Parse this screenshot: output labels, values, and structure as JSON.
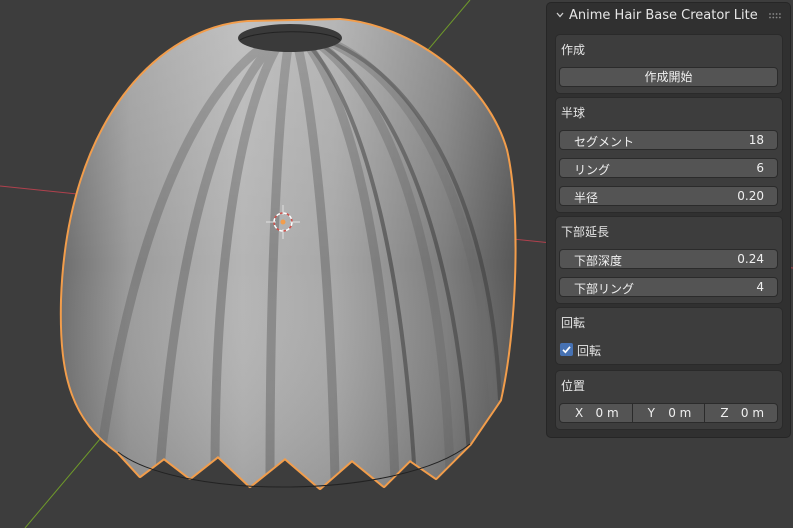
{
  "panel": {
    "title": "Anime Hair Base Creator Lite"
  },
  "sections": {
    "create": {
      "title": "作成",
      "button_label": "作成開始"
    },
    "hemisphere": {
      "title": "半球",
      "fields": [
        {
          "label": "セグメント",
          "value": "18"
        },
        {
          "label": "リング",
          "value": "6"
        },
        {
          "label": "半径",
          "value": "0.20"
        }
      ]
    },
    "lower_extension": {
      "title": "下部延長",
      "fields": [
        {
          "label": "下部深度",
          "value": "0.24"
        },
        {
          "label": "下部リング",
          "value": "4"
        }
      ]
    },
    "rotation": {
      "title": "回転",
      "checkbox_label": "回転",
      "checked": true
    },
    "position": {
      "title": "位置",
      "axes": [
        {
          "axis": "X",
          "value": "0 m"
        },
        {
          "axis": "Y",
          "value": "0 m"
        },
        {
          "axis": "Z",
          "value": "0 m"
        }
      ]
    }
  },
  "colors": {
    "viewport_bg": "#3d3d3d",
    "selection_outline": "#f29d4b",
    "x_axis": "#b0414d",
    "y_axis": "#6f9a2a",
    "checkbox_accent": "#4772b3"
  },
  "icons": {
    "collapse": "chevron-down-icon",
    "drag": "grip-dots-icon",
    "object_origin": "3d-cursor-icon",
    "checkbox": "checkmark-icon"
  }
}
